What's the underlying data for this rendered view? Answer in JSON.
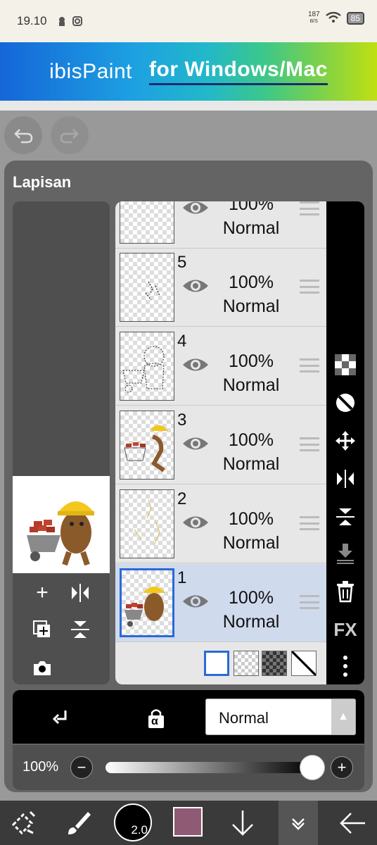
{
  "status_bar": {
    "time": "19.10",
    "net_speed_top": "187",
    "net_speed_bottom": "B/S",
    "battery": "85"
  },
  "banner": {
    "logo": "ibisPaint",
    "slogan": "for Windows/Mac"
  },
  "panel": {
    "title": "Lapisan"
  },
  "layers": [
    {
      "number": "",
      "opacity": "100%",
      "mode": "Normal",
      "selected": false
    },
    {
      "number": "5",
      "opacity": "100%",
      "mode": "Normal",
      "selected": false
    },
    {
      "number": "4",
      "opacity": "100%",
      "mode": "Normal",
      "selected": false
    },
    {
      "number": "3",
      "opacity": "100%",
      "mode": "Normal",
      "selected": false
    },
    {
      "number": "2",
      "opacity": "100%",
      "mode": "Normal",
      "selected": false
    },
    {
      "number": "1",
      "opacity": "100%",
      "mode": "Normal",
      "selected": true
    }
  ],
  "blend": {
    "mode": "Normal",
    "alpha_lock_label": "α"
  },
  "opacity": {
    "label": "100%",
    "value": 1.0
  },
  "right_tools": {
    "fx_label": "FX"
  },
  "bottom_bar": {
    "brush_size": "2.0",
    "color": "#8e5a74"
  }
}
